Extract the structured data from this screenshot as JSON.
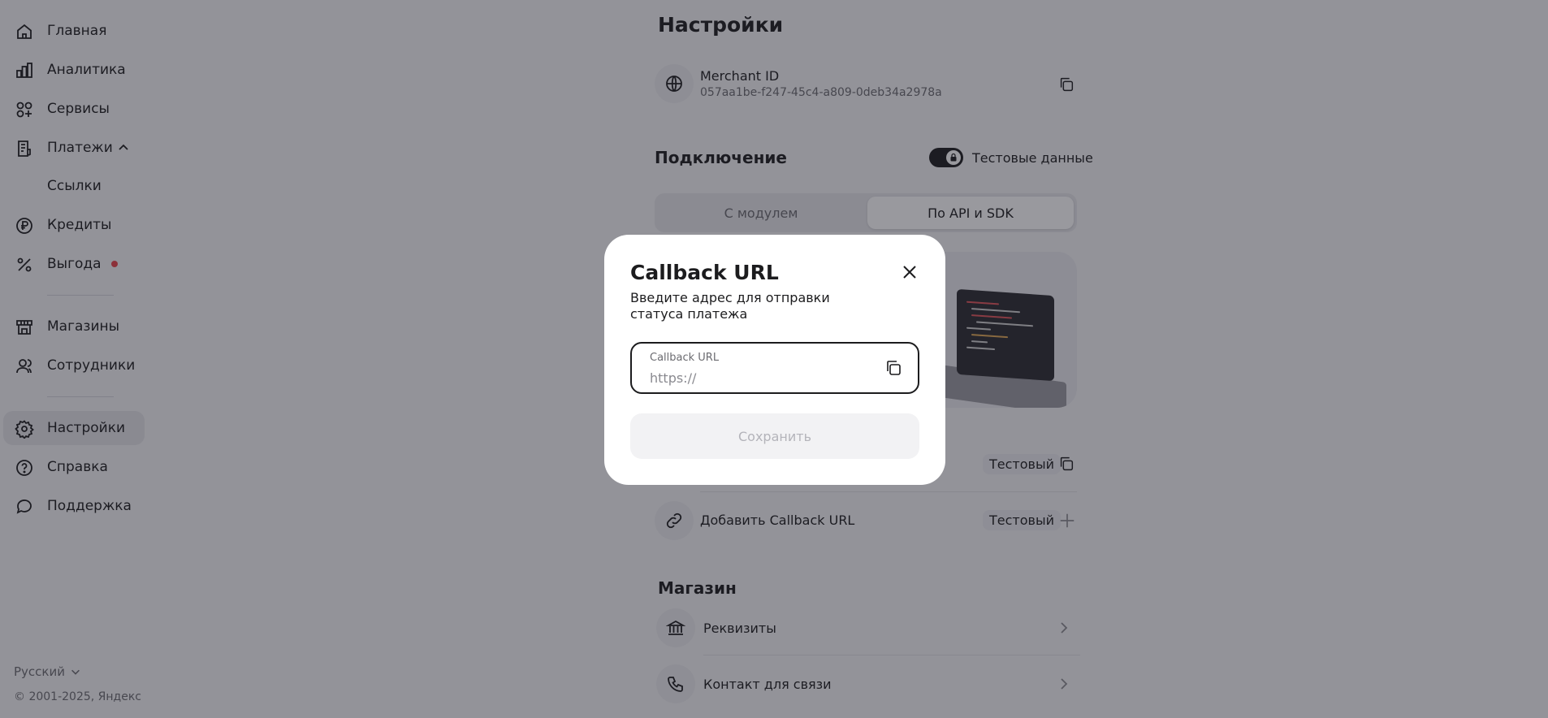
{
  "sidebar": {
    "items": [
      {
        "label": "Главная",
        "icon": "home-icon"
      },
      {
        "label": "Аналитика",
        "icon": "analytics-icon"
      },
      {
        "label": "Сервисы",
        "icon": "services-icon"
      },
      {
        "label": "Платежи",
        "icon": "payments-icon"
      },
      {
        "label": "Ссылки"
      },
      {
        "label": "Кредиты",
        "icon": "ruble-icon"
      },
      {
        "label": "Выгода",
        "icon": "percent-icon"
      },
      {
        "label": "Магазины",
        "icon": "shop-icon"
      },
      {
        "label": "Сотрудники",
        "icon": "employees-icon"
      },
      {
        "label": "Настройки",
        "icon": "gear-icon"
      },
      {
        "label": "Справка",
        "icon": "help-icon"
      },
      {
        "label": "Поддержка",
        "icon": "chat-icon"
      }
    ],
    "language": "Русский",
    "copyright": "© 2001-2025, Яндекс"
  },
  "main": {
    "title": "Настройки",
    "merchant": {
      "title": "Merchant ID",
      "id": "057aa1be-f247-45c4-a809-0deb34a2978a"
    },
    "connection": {
      "title": "Подключение",
      "toggle_label": "Тестовые данные",
      "tabs": [
        "С модулем",
        "По API и SDK"
      ]
    },
    "rows": [
      {
        "badge": "Тестовый"
      },
      {
        "title": "Добавить Callback URL",
        "badge": "Тестовый"
      }
    ],
    "shop": {
      "title": "Магазин",
      "items": [
        "Реквизиты",
        "Контакт для связи"
      ]
    }
  },
  "modal": {
    "title": "Callback URL",
    "description": "Введите адрес для отправки статуса платежа",
    "field_label": "Callback URL",
    "field_placeholder": "https://",
    "save_label": "Сохранить"
  },
  "colors": {
    "accent": "#1c1c1e",
    "notification_dot": "#e8424a",
    "overlay": "rgba(28,28,40,0.45)"
  }
}
